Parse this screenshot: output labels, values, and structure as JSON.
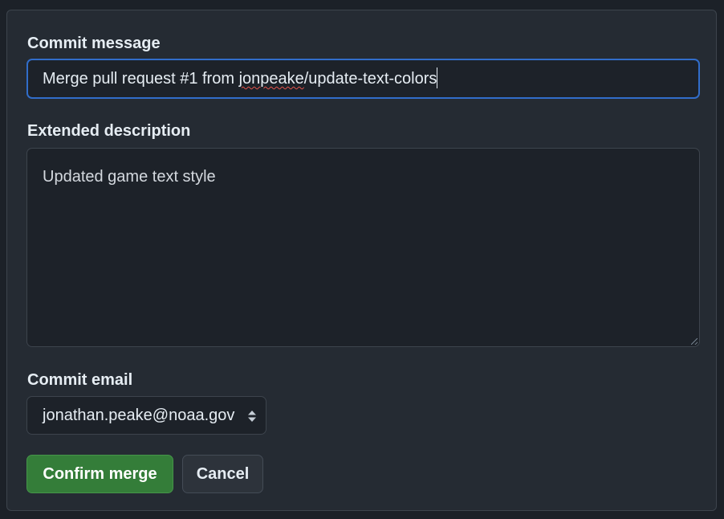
{
  "form": {
    "commit_message_label": "Commit message",
    "commit_message_value_before": "Merge pull request #1 from ",
    "commit_message_value_flagged": "jonpeake",
    "commit_message_value_after": "/update-text-colors",
    "extended_description_label": "Extended description",
    "extended_description_value": "Updated game text style",
    "commit_email_label": "Commit email",
    "commit_email_value": "jonathan.peake@noaa.gov",
    "confirm_label": "Confirm merge",
    "cancel_label": "Cancel"
  },
  "colors": {
    "panel_bg": "#252b33",
    "input_bg": "#1d2229",
    "focus_border": "#316dca",
    "primary_button": "#347d39",
    "spellcheck_underline": "#e5534b"
  },
  "icons": {
    "select_indicator": "select-updown-icon",
    "resize": "resize-grip-icon"
  }
}
